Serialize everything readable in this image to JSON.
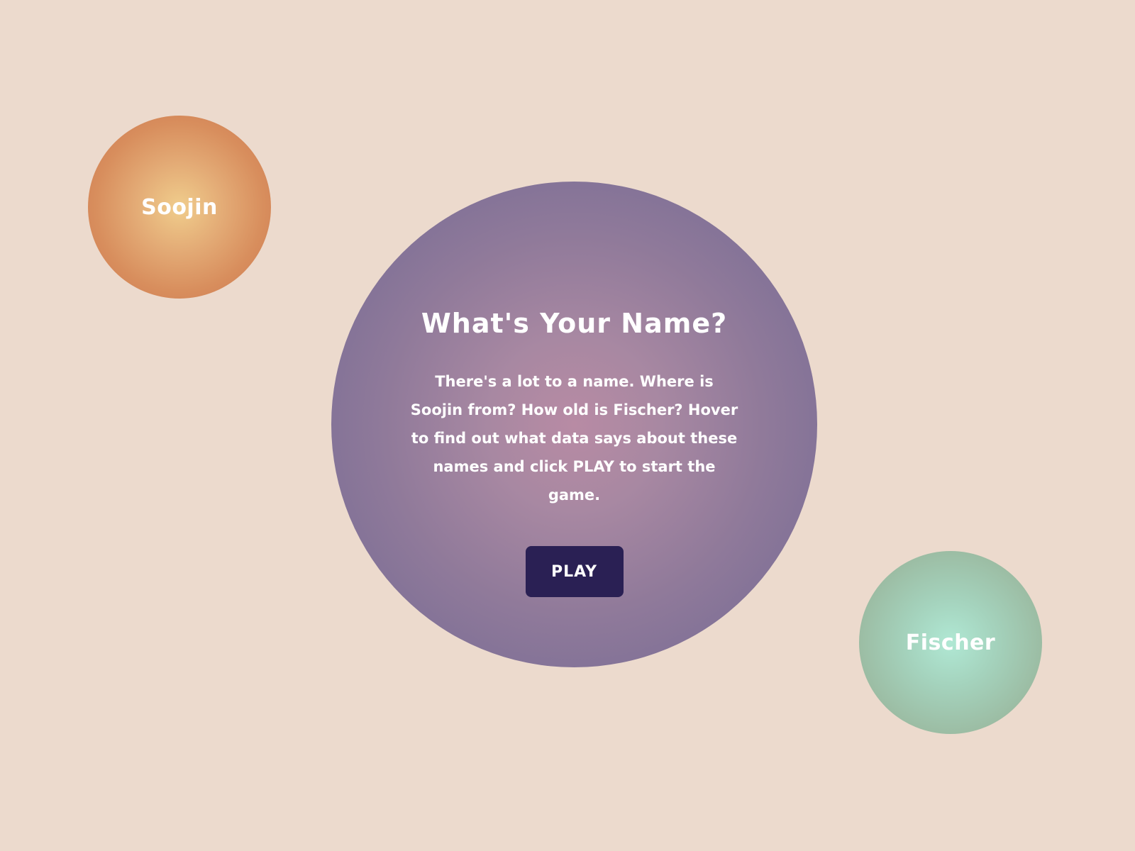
{
  "page": {
    "background_color": "#ecdacd"
  },
  "bubbles": [
    {
      "name": "Soojin",
      "color": "#d88e5d"
    },
    {
      "name": "Fischer",
      "color": "#9cbda4"
    }
  ],
  "intro": {
    "title": "What's Your Name?",
    "description": "There's a lot to a name. Where is Soojin from? How old is Fischer? Hover to find out what data says about these names and click PLAY to start the game.",
    "play_label": "PLAY",
    "play_button_color": "#2a2054",
    "circle_color": "#7b6e96"
  }
}
